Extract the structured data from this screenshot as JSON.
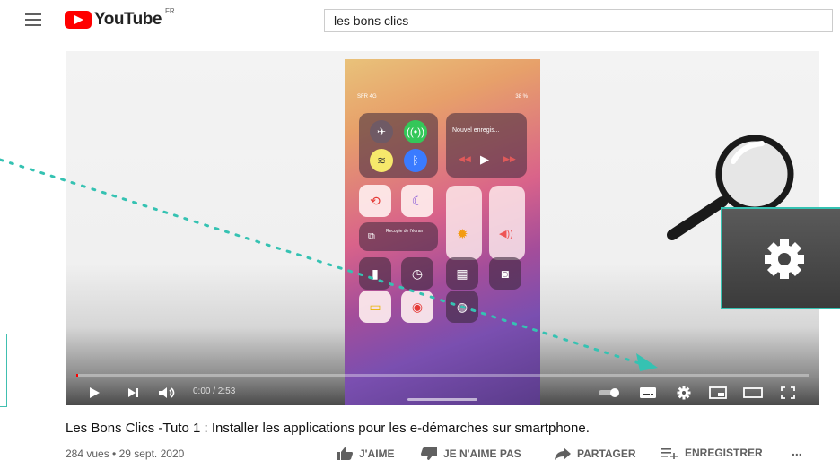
{
  "header": {
    "logo_text": "YouTube",
    "country_code": "FR",
    "search_value": "les bons clics"
  },
  "phone": {
    "carrier": "SFR 4G",
    "battery": "38 %",
    "music_title": "Nouvel enregis...",
    "mirroring_label": "Recopie de l'écran"
  },
  "player": {
    "time": "0:00 / 2:53",
    "progress_fraction": 0.002
  },
  "video": {
    "title": "Les Bons Clics -Tuto 1 : Installer les applications pour les e-démarches sur smartphone.",
    "meta": "284 vues • 29 sept. 2020"
  },
  "actions": {
    "like": "J'AIME",
    "dislike": "JE N'AIME PAS",
    "share": "PARTAGER",
    "save": "ENREGISTRER",
    "more": "..."
  },
  "colors": {
    "accent": "#ff0000",
    "annotation": "#35c2b2"
  }
}
